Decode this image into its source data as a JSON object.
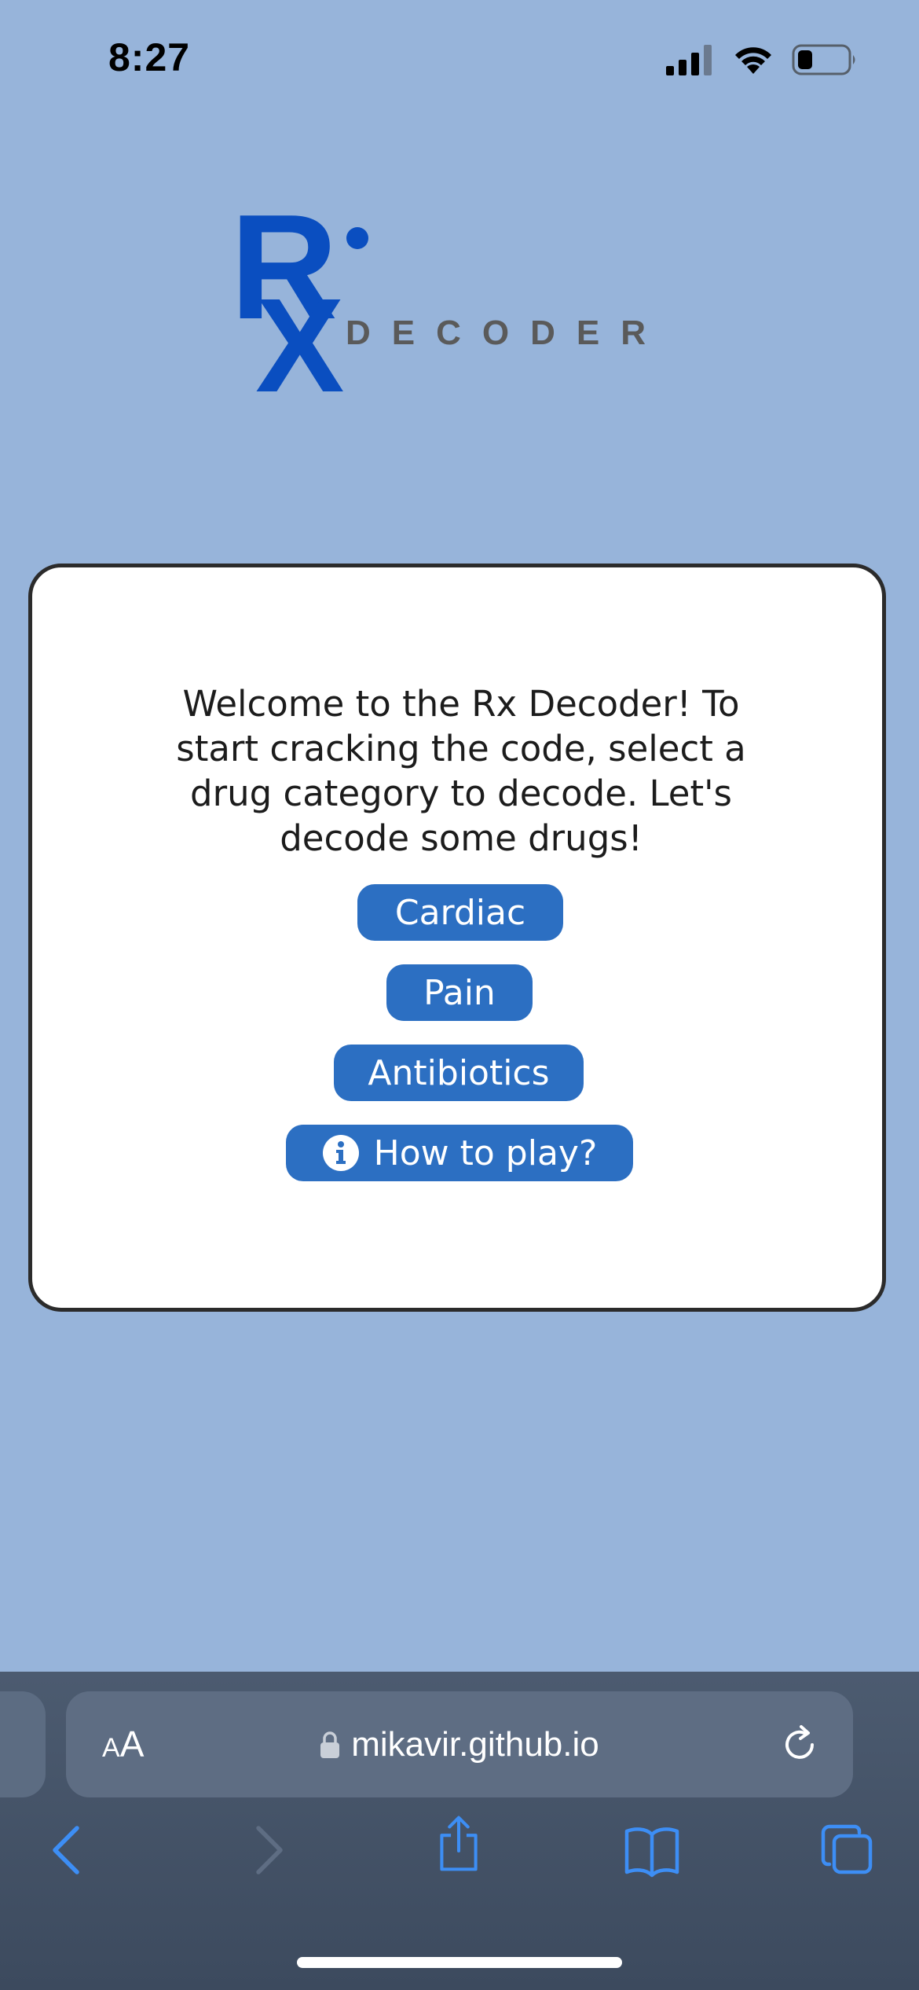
{
  "status_bar": {
    "time": "8:27",
    "icons": [
      "cellular-signal-icon",
      "wifi-icon",
      "battery-icon"
    ]
  },
  "logo": {
    "mark": "Rx",
    "wordmark": "DECODER",
    "color": "#0a4ec0",
    "wordmark_color": "#5a5a5a"
  },
  "card": {
    "intro_text": "Welcome to the Rx Decoder! To start cracking the code, select a drug category to decode. Let's decode some drugs!",
    "buttons": {
      "cardiac": "Cardiac",
      "pain": "Pain",
      "antibiotics": "Antibiotics",
      "how_to_play": "How to play?"
    },
    "button_icon": "info-icon"
  },
  "browser": {
    "text_size_label_small": "A",
    "text_size_label_large": "A",
    "url": "mikavir.github.io",
    "toolbar_icons": [
      "back-icon",
      "forward-icon",
      "share-icon",
      "bookmarks-icon",
      "tabs-icon"
    ]
  },
  "colors": {
    "background": "#97b4da",
    "button": "#2c6fc2",
    "accent": "#3d8ef5",
    "chrome": "#46546a"
  }
}
